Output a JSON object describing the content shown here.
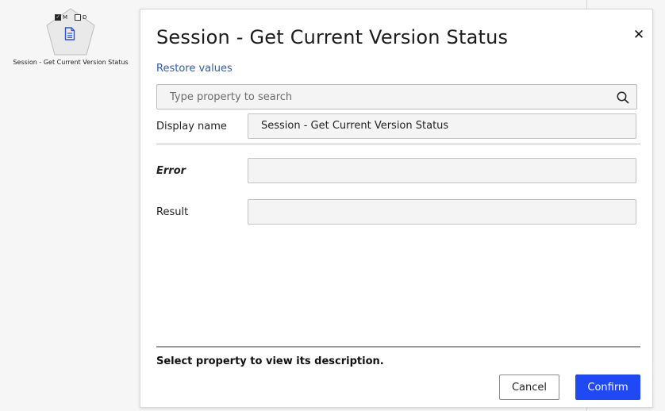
{
  "canvas": {
    "node": {
      "checkbox_m": {
        "label": "M",
        "checked": true
      },
      "checkbox_d": {
        "label": "D",
        "checked": false
      },
      "icon": "document-icon",
      "label": "Session - Get Current Version Status"
    }
  },
  "dialog": {
    "title": "Session - Get Current Version Status",
    "close_icon": "close-icon",
    "restore_link": "Restore values",
    "search": {
      "placeholder": "Type property to search",
      "value": "",
      "icon": "search-icon"
    },
    "properties": [
      {
        "label": "Display name",
        "value": "Session - Get Current Version Status"
      },
      {
        "label": "Error",
        "value": ""
      },
      {
        "label": "Result",
        "value": ""
      }
    ],
    "description": "Select property to view its description.",
    "buttons": {
      "cancel": "Cancel",
      "confirm": "Confirm"
    },
    "colors": {
      "accent": "#1f49f2",
      "link": "#2e5bb8"
    }
  }
}
